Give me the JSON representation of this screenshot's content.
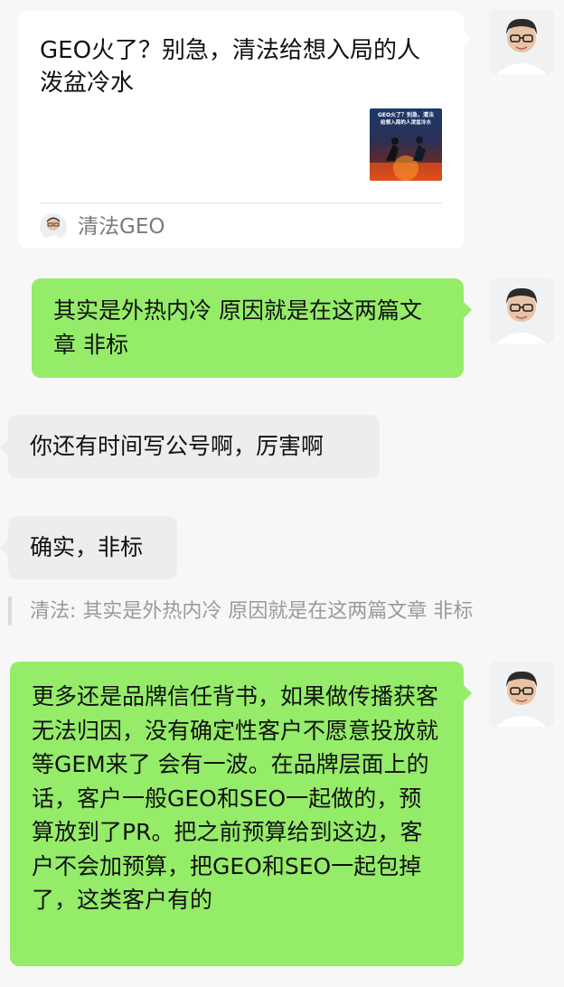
{
  "messages": [
    {
      "type": "link_card",
      "side": "right",
      "title": "GEO火了？别急，清法给想入局的人泼盆冷水",
      "thumb_title": "GEO火了？别急，清法给想入局的人泼盆冷水",
      "source": "清法GEO"
    },
    {
      "type": "text",
      "side": "right",
      "text": "其实是外热内冷 原因就是在这两篇文章 非标"
    },
    {
      "type": "text",
      "side": "left",
      "text": "你还有时间写公号啊，厉害啊"
    },
    {
      "type": "text",
      "side": "left",
      "text": "确实，非标",
      "quote": "清法: 其实是外热内冷 原因就是在这两篇文章 非标"
    },
    {
      "type": "text",
      "side": "right",
      "text": "更多还是品牌信任背书，如果做传播获客无法归因，没有确定性客户不愿意投放就等GEM来了 会有一波。在品牌层面上的话，客户一般GEO和SEO一起做的，预算放到了PR。把之前预算给到这边，客户不会加预算，把GEO和SEO一起包掉了，这类客户有的"
    }
  ],
  "colors": {
    "background": "#f7f7f7",
    "green_bubble": "#95ec69",
    "white_bubble": "#ffffff",
    "gray_bubble": "#ededed"
  }
}
